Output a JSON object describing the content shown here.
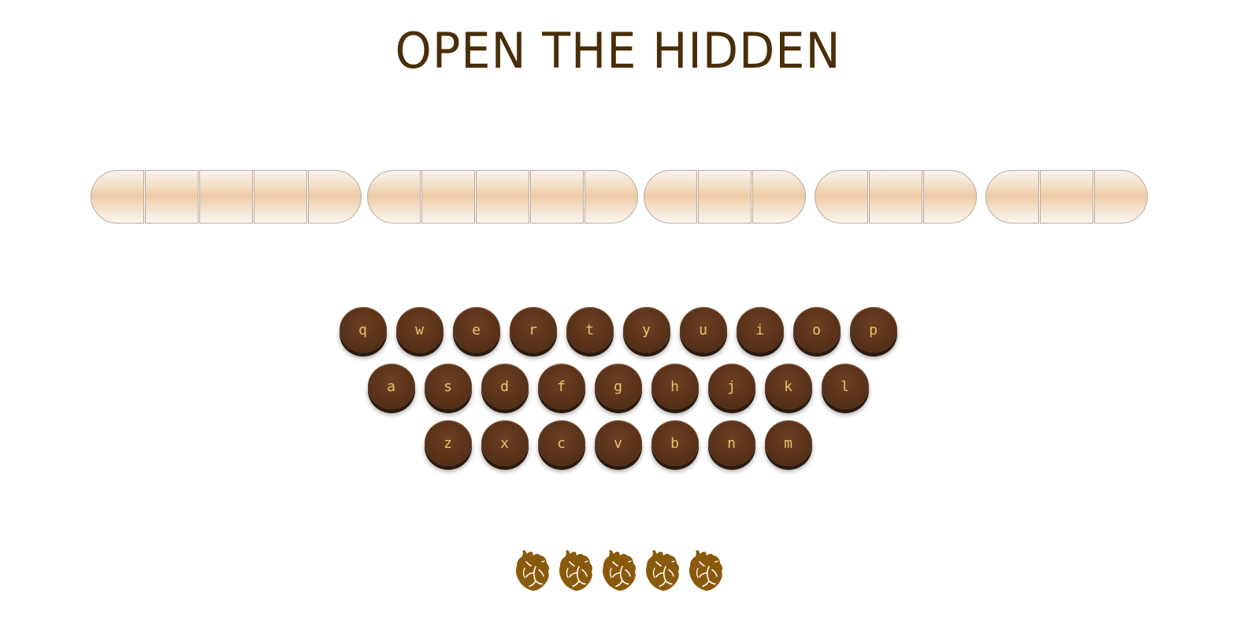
{
  "title": "OPEN THE HIDDEN",
  "word_lengths": [
    5,
    5,
    3,
    3,
    3
  ],
  "keyboard": {
    "rows": [
      [
        "q",
        "w",
        "e",
        "r",
        "t",
        "y",
        "u",
        "i",
        "o",
        "p"
      ],
      [
        "a",
        "s",
        "d",
        "f",
        "g",
        "h",
        "j",
        "k",
        "l"
      ],
      [
        "z",
        "x",
        "c",
        "v",
        "b",
        "n",
        "m"
      ]
    ]
  },
  "lives": {
    "count": 5,
    "icon": "anatomical-heart-icon",
    "color": "#8a5a0c"
  },
  "colors": {
    "title": "#4a2e07",
    "key_face": "#5a331b",
    "key_label": "#e9c46b",
    "slot_fill": "#eecba6"
  }
}
